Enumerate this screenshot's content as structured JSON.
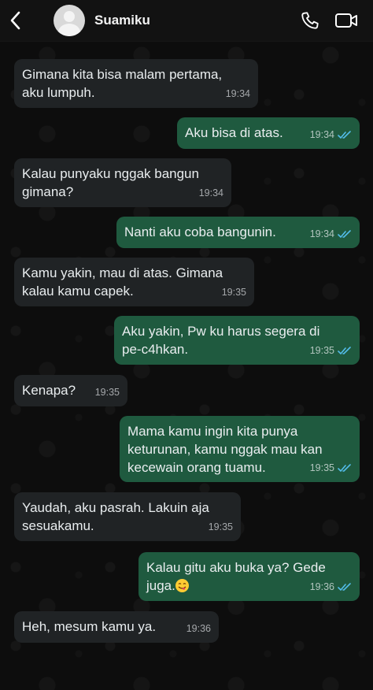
{
  "header": {
    "contact_name": "Suamiku",
    "back_icon": "chevron-left-icon",
    "call_icon": "phone-icon",
    "video_icon": "video-camera-icon"
  },
  "colors": {
    "incoming_bubble": "#202325",
    "outgoing_bubble": "#1f5a3f",
    "read_tick": "#53bdeb",
    "background": "#0d0d0d"
  },
  "messages": [
    {
      "direction": "in",
      "text": "Gimana kita bisa malam pertama,\naku lumpuh.",
      "time": "19:34"
    },
    {
      "direction": "out",
      "text": "Aku bisa di atas.",
      "time": "19:34",
      "status": "read"
    },
    {
      "direction": "in",
      "text": "Kalau punyaku nggak bangun\ngimana?",
      "time": "19:34"
    },
    {
      "direction": "out",
      "text": "Nanti aku coba bangunin.",
      "time": "19:34",
      "status": "read"
    },
    {
      "direction": "in",
      "text": "Kamu yakin, mau di atas. Gimana\nkalau kamu capek.",
      "time": "19:35"
    },
    {
      "direction": "out",
      "text": "Aku yakin, Pw ku harus segera di\npe-c4hkan.",
      "time": "19:35",
      "status": "read"
    },
    {
      "direction": "in",
      "text": "Kenapa?",
      "time": "19:35"
    },
    {
      "direction": "out",
      "text": "Mama kamu ingin kita punya\nketurunan, kamu nggak mau kan\nkecewain orang tuamu.",
      "time": "19:35",
      "status": "read"
    },
    {
      "direction": "in",
      "text": "Yaudah, aku pasrah. Lakuin aja\nsesuakamu.",
      "time": "19:35"
    },
    {
      "direction": "out",
      "text": "Kalau gitu aku buka ya? Gede\njuga.",
      "emoji": "😋",
      "time": "19:36",
      "status": "read"
    },
    {
      "direction": "in",
      "text": "Heh, mesum kamu ya.",
      "time": "19:36"
    }
  ]
}
